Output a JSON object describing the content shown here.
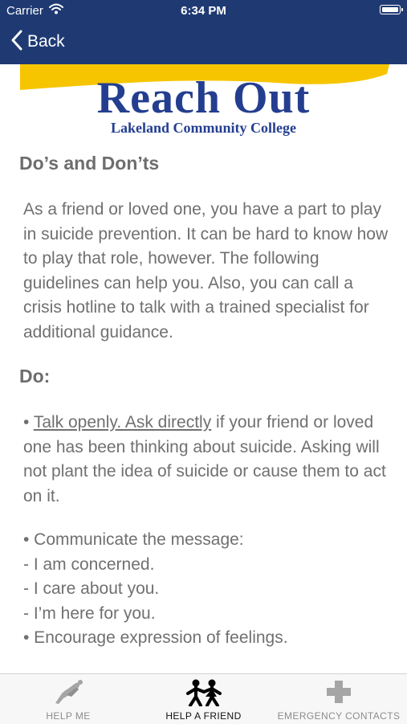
{
  "status_bar": {
    "carrier": "Carrier",
    "time": "6:34 PM"
  },
  "nav": {
    "back_label": "Back"
  },
  "logo": {
    "title": "Reach Out",
    "subtitle": "Lakeland Community College"
  },
  "content": {
    "heading": "Do’s and Don’ts",
    "intro": "As a friend or loved one, you have a part to play in suicide prevention. It can be hard to know how to play that role, however. The following guidelines can help you. Also, you can call a crisis hotline to talk with a trained specialist for additional guidance.",
    "do_heading": "Do:",
    "item1": {
      "bullet": "•",
      "link_text": "Talk openly. Ask directly",
      "rest": "if your friend or loved one has been thinking about suicide. Asking will not plant the idea of suicide or cause them to act on it."
    },
    "item2": {
      "lines": [
        "• Communicate the message:",
        "- I am concerned.",
        "- I care about you.",
        "- I’m here for you.",
        "• Encourage expression of feelings."
      ]
    }
  },
  "tabs": [
    {
      "label": "HELP ME",
      "icon": "help-me-icon",
      "active": false
    },
    {
      "label": "HELP A FRIEND",
      "icon": "help-a-friend-icon",
      "active": true
    },
    {
      "label": "EMERGENCY CONTACTS",
      "icon": "emergency-cross-icon",
      "active": false
    }
  ],
  "colors": {
    "nav_background": "#1f3a73",
    "logo_blue": "#243e8f",
    "logo_yellow": "#f6c500",
    "body_text": "#707070",
    "tab_inactive": "#8c8c8c",
    "tab_active": "#111111"
  }
}
